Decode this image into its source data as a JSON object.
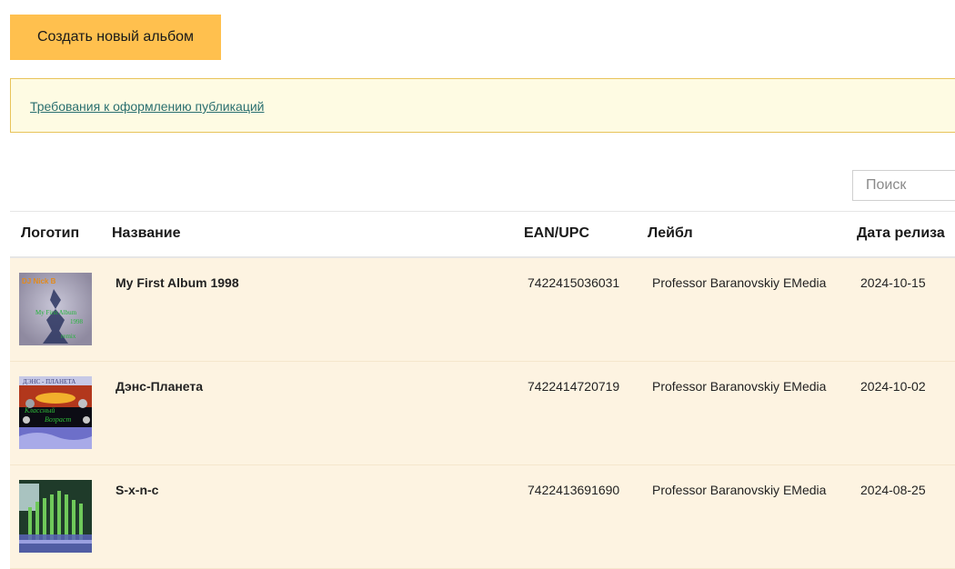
{
  "toolbar": {
    "create_album_label": "Создать новый альбом"
  },
  "notice": {
    "link_text": "Требования к оформлению публикаций"
  },
  "search": {
    "placeholder": "Поиск"
  },
  "table": {
    "headers": {
      "logo": "Логотип",
      "title": "Название",
      "ean": "EAN/UPC",
      "label": "Лейбл",
      "release_date": "Дата релиза"
    },
    "rows": [
      {
        "title": "My First Album 1998",
        "ean": "7422415036031",
        "label": "Professor Baranovskiy EMedia",
        "release_date": "2024-10-15",
        "cover_icon": "album-cover-1"
      },
      {
        "title": "Дэнс-Планета",
        "ean": "7422414720719",
        "label": "Professor Baranovskiy EMedia",
        "release_date": "2024-10-02",
        "cover_icon": "album-cover-2"
      },
      {
        "title": "S-x-n-c",
        "ean": "7422413691690",
        "label": "Professor Baranovskiy EMedia",
        "release_date": "2024-08-25",
        "cover_icon": "album-cover-3"
      }
    ]
  },
  "colors": {
    "accent": "#ffc04e",
    "notice_bg": "#fefbe3",
    "row_bg": "#fdf3e1",
    "link": "#2a6f6f"
  }
}
